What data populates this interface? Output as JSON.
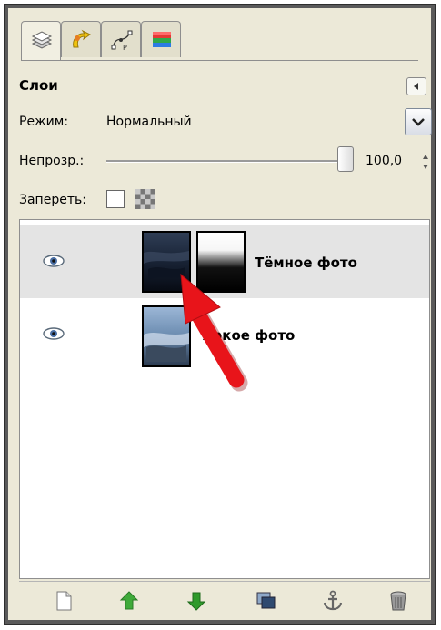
{
  "tabs": [
    {
      "icon": "layers-icon",
      "active": true
    },
    {
      "icon": "channels-icon"
    },
    {
      "icon": "paths-icon"
    },
    {
      "icon": "colormap-icon"
    }
  ],
  "panel": {
    "title": "Слои"
  },
  "mode": {
    "label": "Режим:",
    "value": "Нормальный"
  },
  "opacity": {
    "label": "Непрозр.:",
    "value": "100,0",
    "level": 1.0
  },
  "lock": {
    "label": "Запереть:"
  },
  "layers": [
    {
      "name": "Тёмное фото",
      "visible": true,
      "selected": true,
      "has_mask": true
    },
    {
      "name": "Яркое фото",
      "visible": true,
      "selected": false,
      "has_mask": false
    }
  ],
  "bottom_buttons": [
    {
      "icon": "new-layer-icon"
    },
    {
      "icon": "raise-layer-icon"
    },
    {
      "icon": "lower-layer-icon"
    },
    {
      "icon": "duplicate-layer-icon"
    },
    {
      "icon": "anchor-layer-icon"
    },
    {
      "icon": "delete-layer-icon"
    }
  ],
  "colors": {
    "arrow": "#e8141a",
    "selected_row": "#e4e4e4",
    "up_arrow": "#3faa3a",
    "down_arrow": "#2f9a2b"
  }
}
